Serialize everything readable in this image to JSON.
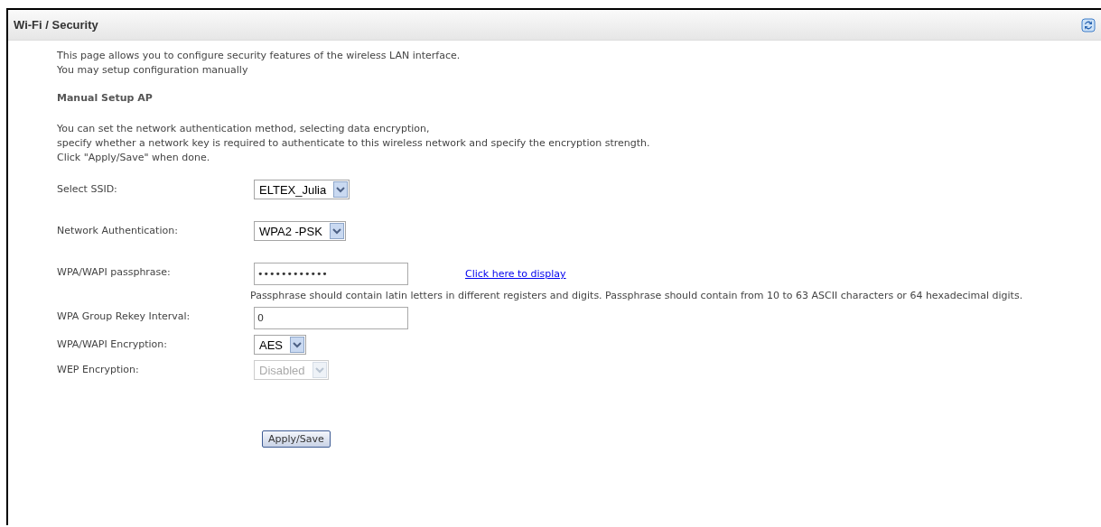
{
  "header": {
    "title": "Wi-Fi / Security"
  },
  "intro": [
    "This page allows you to configure security features of the wireless LAN interface.",
    "You may setup configuration manually"
  ],
  "section_title": "Manual Setup AP",
  "description": [
    "You can set the network authentication method, selecting data encryption,",
    "specify whether a network key is required to authenticate to this wireless network and specify the encryption strength.",
    "Click \"Apply/Save\" when done."
  ],
  "fields": [
    {
      "kind": "select",
      "label": "Select SSID:",
      "value": "ELTEX_Julia",
      "disabled": false
    },
    {
      "kind": "select",
      "label": "Network Authentication:",
      "value": "WPA2 -PSK",
      "disabled": false
    },
    {
      "kind": "password",
      "label": "WPA/WAPI passphrase:",
      "value": "••••••••••••",
      "link": "Click here to display",
      "hint": "Passphrase should contain latin letters in different registers and digits. Passphrase should contain from 10 to 63 ASCII characters or 64 hexadecimal digits."
    },
    {
      "kind": "text",
      "label": "WPA Group Rekey Interval:",
      "value": "0"
    },
    {
      "kind": "select",
      "label": "WPA/WAPI Encryption:",
      "value": "AES",
      "disabled": false
    },
    {
      "kind": "select",
      "label": "WEP Encryption:",
      "value": "Disabled",
      "disabled": true
    }
  ],
  "button": "Apply/Save"
}
